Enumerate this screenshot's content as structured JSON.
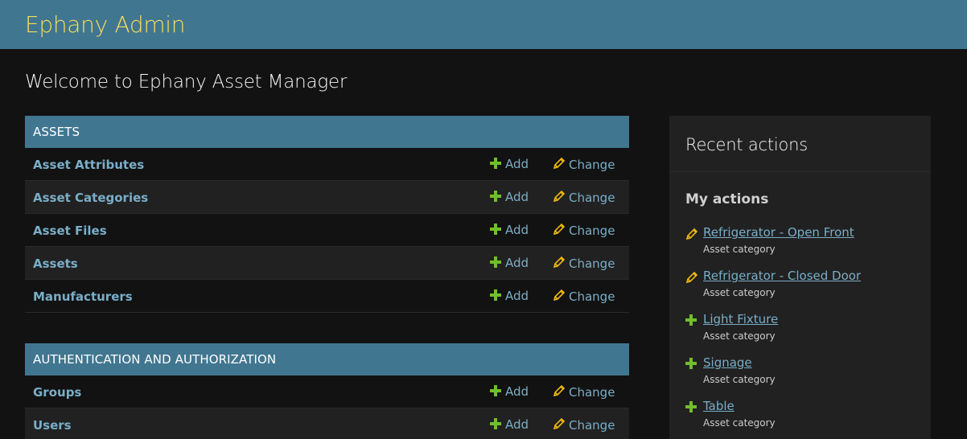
{
  "header": {
    "branding": "Ephany Admin",
    "background": "#417690",
    "branding_color": "#f5dd5d"
  },
  "content": {
    "title": "Welcome to Ephany Asset Manager"
  },
  "modules": [
    {
      "caption": "ASSETS",
      "models": [
        {
          "name": "Asset Attributes",
          "add_label": "Add",
          "change_label": "Change"
        },
        {
          "name": "Asset Categories",
          "add_label": "Add",
          "change_label": "Change"
        },
        {
          "name": "Asset Files",
          "add_label": "Add",
          "change_label": "Change"
        },
        {
          "name": "Assets",
          "add_label": "Add",
          "change_label": "Change"
        },
        {
          "name": "Manufacturers",
          "add_label": "Add",
          "change_label": "Change"
        }
      ]
    },
    {
      "caption": "AUTHENTICATION AND AUTHORIZATION",
      "models": [
        {
          "name": "Groups",
          "add_label": "Add",
          "change_label": "Change"
        },
        {
          "name": "Users",
          "add_label": "Add",
          "change_label": "Change"
        }
      ]
    }
  ],
  "recent_actions": {
    "title": "Recent actions",
    "subtitle": "My actions",
    "items": [
      {
        "icon": "pencil-icon",
        "label": "Refrigerator - Open Front",
        "type": "Asset category"
      },
      {
        "icon": "pencil-icon",
        "label": "Refrigerator - Closed Door",
        "type": "Asset category"
      },
      {
        "icon": "plus-icon",
        "label": "Light Fixture",
        "type": "Asset category"
      },
      {
        "icon": "plus-icon",
        "label": "Signage",
        "type": "Asset category"
      },
      {
        "icon": "plus-icon",
        "label": "Table",
        "type": "Asset category"
      }
    ]
  },
  "colors": {
    "link": "#79aec8",
    "add_icon": "#70bf2b",
    "change_icon": "#efb80b",
    "background": "#121212"
  }
}
